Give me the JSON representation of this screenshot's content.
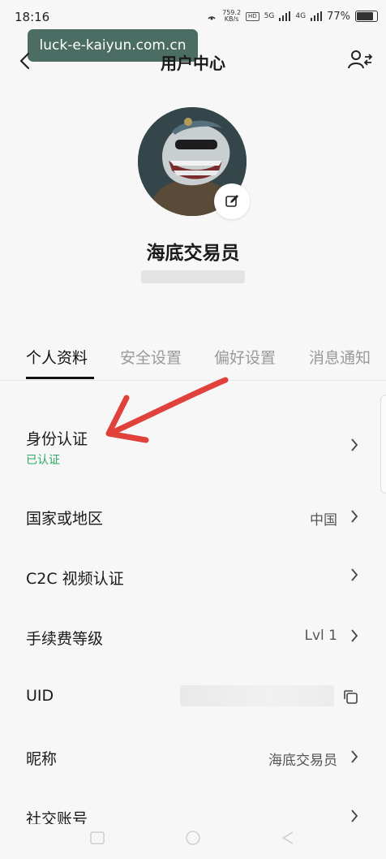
{
  "status_bar": {
    "time": "18:16",
    "speed_value": "759.2",
    "speed_unit": "KB/s",
    "chip1": "HD",
    "network1": "5G",
    "network2": "4G",
    "battery": "77%",
    "battery_level": 0.77
  },
  "watermark": "luck-e-kaiyun.com.cn",
  "header": {
    "title": "用户中心"
  },
  "profile": {
    "nickname": "海底交易员"
  },
  "tabs": [
    {
      "label": "个人资料",
      "active": true
    },
    {
      "label": "安全设置",
      "active": false
    },
    {
      "label": "偏好设置",
      "active": false
    },
    {
      "label": "消息通知",
      "active": false
    }
  ],
  "rows": [
    {
      "label": "身份认证",
      "sub": "已认证",
      "value": ""
    },
    {
      "label": "国家或地区",
      "value": "中国"
    },
    {
      "label": "C2C 视频认证",
      "value": ""
    },
    {
      "label": "手续费等级",
      "value": "Lvl 1"
    },
    {
      "label": "UID",
      "value": ""
    },
    {
      "label": "昵称",
      "value": "海底交易员"
    },
    {
      "label": "社交账号",
      "value": ""
    }
  ],
  "colors": {
    "verified": "#2ea765",
    "annotation_arrow": "#e0413a",
    "watermark_bg": "#345a4e"
  }
}
